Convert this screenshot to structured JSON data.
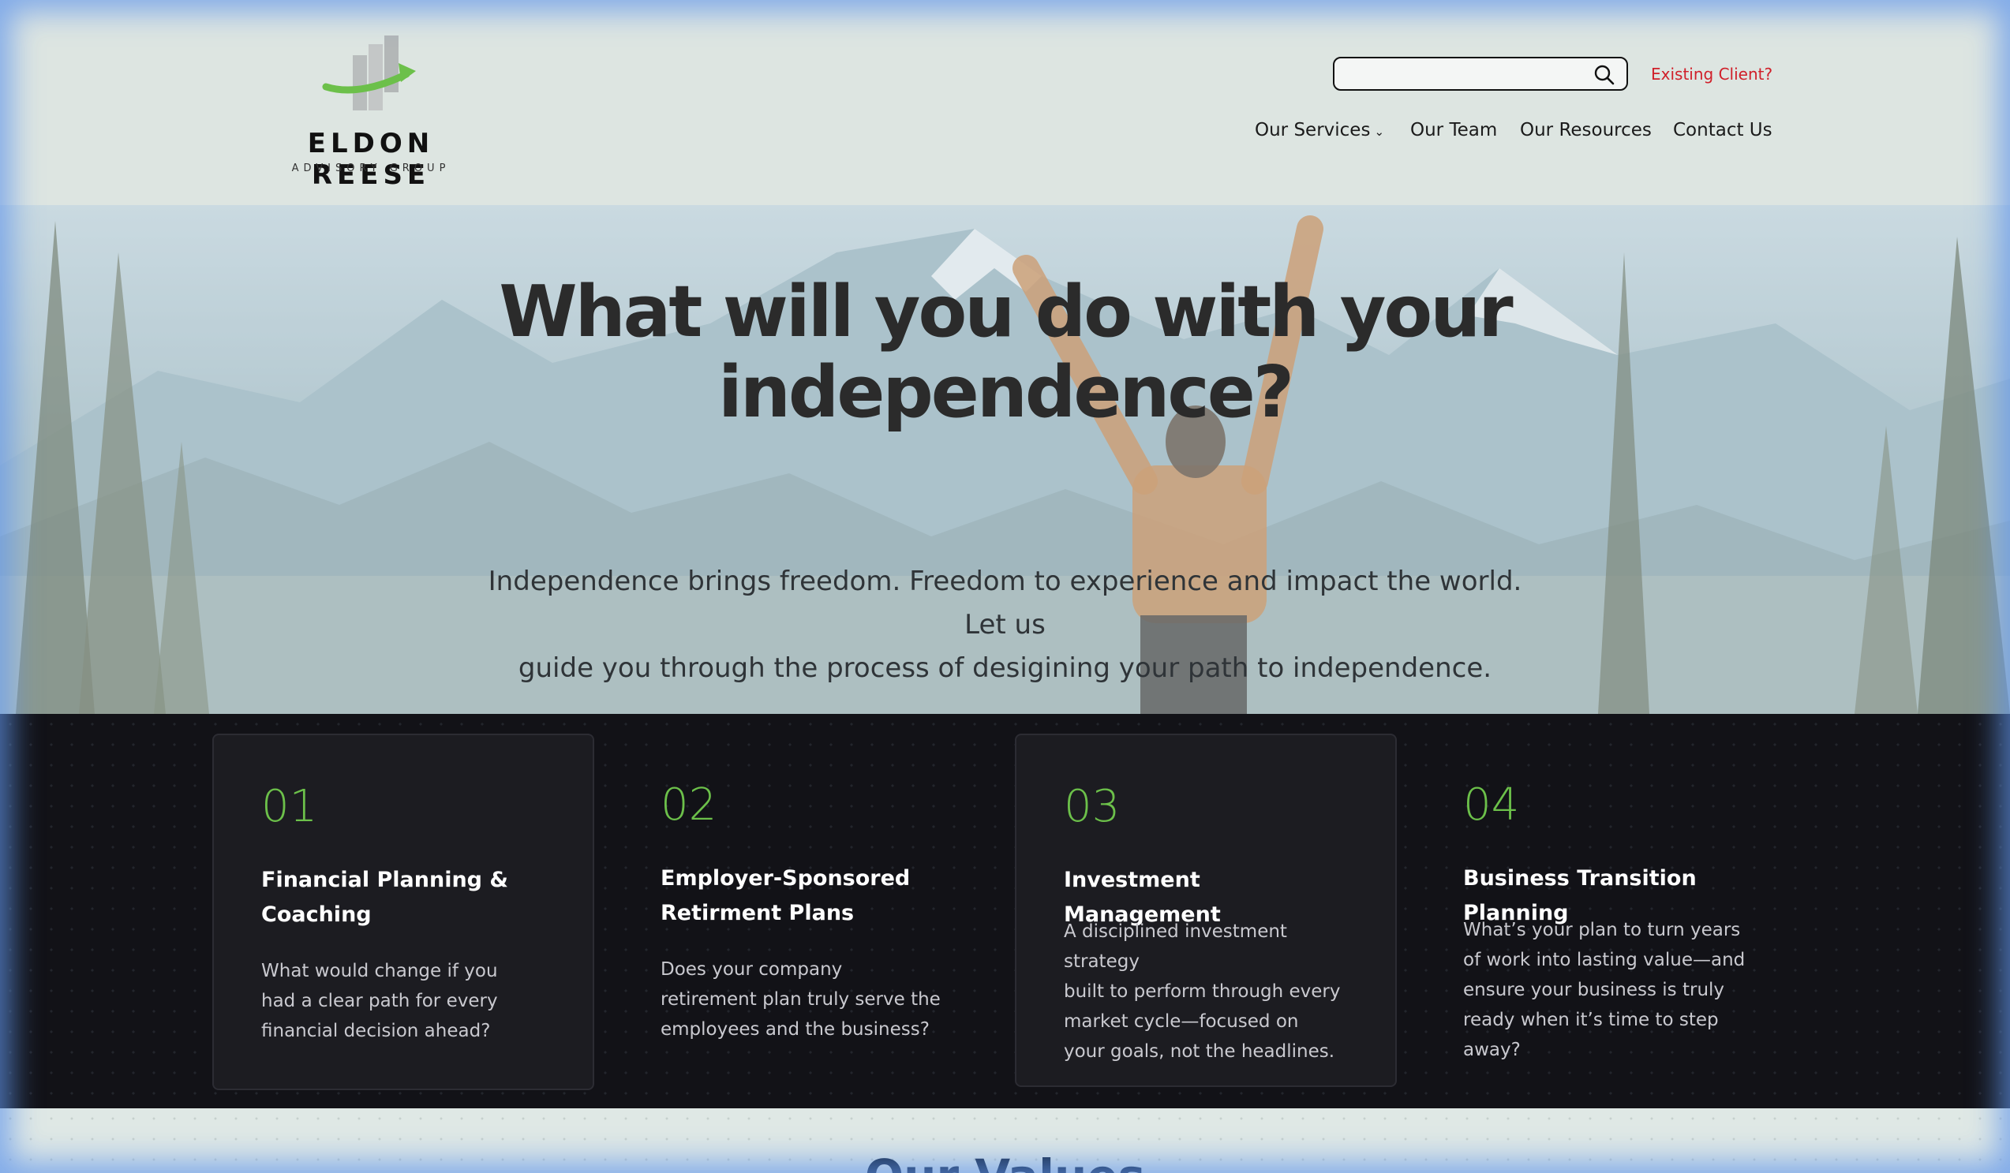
{
  "brand": {
    "name": "ELDON REESE",
    "tagline": "ADVISORY GROUP"
  },
  "header": {
    "search": {
      "value": "",
      "placeholder": ""
    },
    "existing_client": "Existing Client?",
    "nav": [
      {
        "label": "Our Services",
        "has_dropdown": true
      },
      {
        "label": "Our Team"
      },
      {
        "label": "Our Resources"
      },
      {
        "label": "Contact Us"
      }
    ]
  },
  "hero": {
    "title_line1": "What will you do with your",
    "title_line2": "independence?",
    "subtitle_line1": "Independence brings freedom. Freedom to experience and impact the world. Let us",
    "subtitle_line2": "guide you through the process of desigining your path to independence."
  },
  "services": [
    {
      "number": "01",
      "title_lines": [
        "Financial Planning &",
        "Coaching"
      ],
      "desc_lines": [
        "What would change if you",
        "had a clear path for every",
        "financial decision ahead?"
      ]
    },
    {
      "number": "02",
      "title_lines": [
        "Employer-Sponsored",
        "Retirment Plans"
      ],
      "desc_lines": [
        "Does your company",
        "retirement plan truly serve the",
        "employees and the business?"
      ]
    },
    {
      "number": "03",
      "title_lines": [
        "Investment Management"
      ],
      "desc_lines": [
        "A disciplined investment strategy",
        "built to perform through every",
        "market cycle—focused on",
        "your goals, not the headlines."
      ]
    },
    {
      "number": "04",
      "title_lines": [
        "Business Transition Planning"
      ],
      "desc_lines": [
        "What’s your plan to turn years",
        "of work into lasting value—and",
        "ensure your business is truly",
        "ready when it’s time to step away?"
      ]
    }
  ],
  "values": {
    "heading": "Our Values"
  },
  "colors": {
    "accent_green": "#6cc04a",
    "existing_client_red": "#d0202a",
    "dark_band": "#121217",
    "card_bg": "#1c1c21"
  },
  "icons": [
    "search-icon",
    "chevron-down-icon",
    "logo-bars-arrow-icon"
  ]
}
